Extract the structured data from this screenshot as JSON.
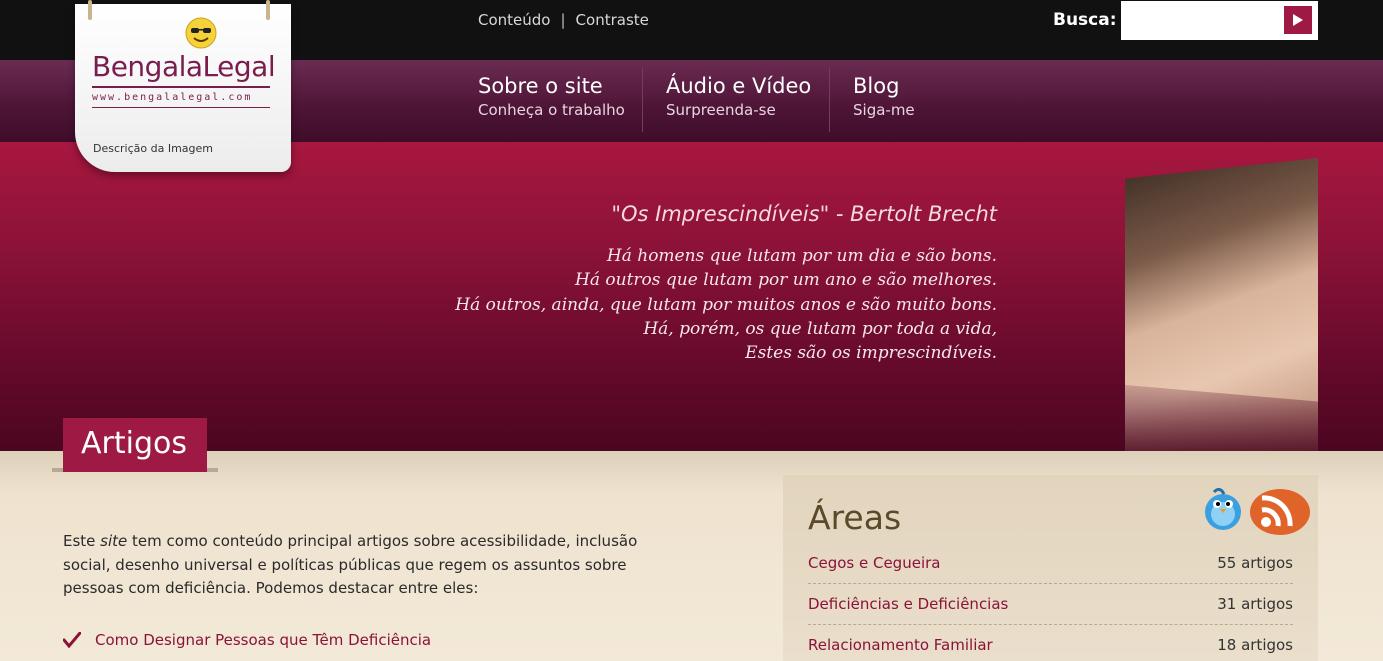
{
  "top": {
    "links": [
      "Conteúdo",
      "Contraste"
    ],
    "separator": "|",
    "search_label": "Busca:",
    "search_placeholder": ""
  },
  "logo": {
    "name": "BengalaLegal",
    "url": "www.bengalalegal.com",
    "caption": "Descrição da Imagem"
  },
  "nav": {
    "items": [
      {
        "title": "Sobre o site",
        "subtitle": "Conheça o trabalho"
      },
      {
        "title": "Áudio e Vídeo",
        "subtitle": "Surpreenda-se"
      },
      {
        "title": "Blog",
        "subtitle": "Siga-me"
      }
    ]
  },
  "hero": {
    "quote_title": "\"Os Imprescindíveis\" - Bertolt Brecht",
    "poem": [
      "Há homens que lutam por um dia e são bons.",
      "Há outros que lutam por um ano e são melhores.",
      "Há outros, ainda, que lutam por muitos anos e são muito bons.",
      "Há, porém, os que lutam por toda a vida,",
      "Estes são os imprescindíveis."
    ]
  },
  "main": {
    "section_title": "Artigos",
    "intro_before": "Este ",
    "intro_em": "site",
    "intro_after": " tem como conteúdo principal artigos sobre acessibilidade, inclusão social, desenho universal e políticas públicas que regem os assuntos sobre pessoas com deficiência. Podemos destacar entre eles:",
    "list": [
      "Como Designar Pessoas que Têm Deficiência"
    ]
  },
  "areas": {
    "title": "Áreas",
    "rows": [
      {
        "name": "Cegos e Cegueira",
        "count": "55 artigos"
      },
      {
        "name": "Deficiências e Deficiências",
        "count": "31 artigos"
      },
      {
        "name": "Relacionamento Familiar",
        "count": "18 artigos"
      }
    ]
  },
  "colors": {
    "accent": "#9e1a44",
    "nav_bg": "#4d1435",
    "link": "#8b1238"
  }
}
